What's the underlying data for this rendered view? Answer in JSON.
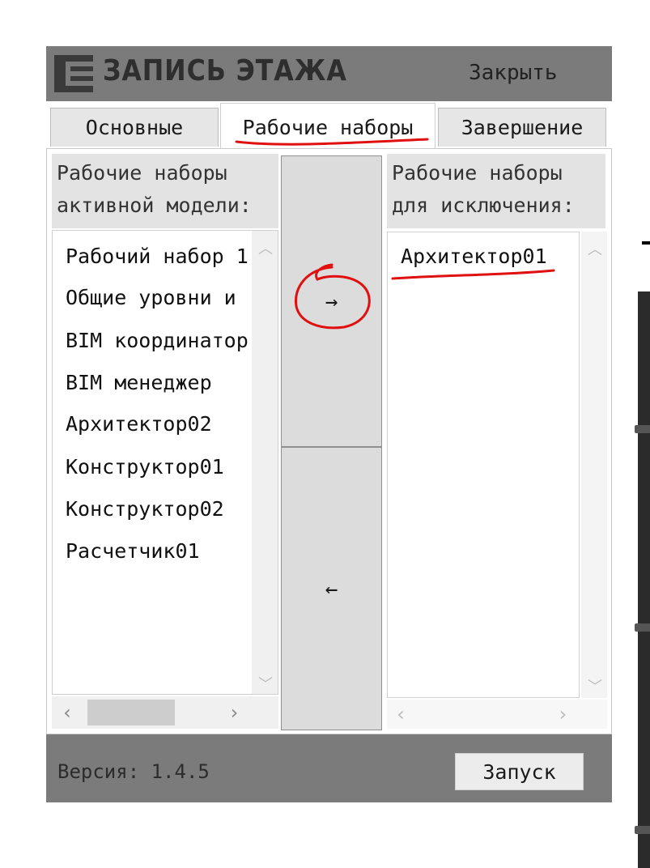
{
  "window": {
    "title": "ЗАПИСЬ ЭТАЖА",
    "close_label": "Закрыть"
  },
  "tabs": [
    {
      "label": "Основные",
      "active": false
    },
    {
      "label": "Рабочие наборы",
      "active": true
    },
    {
      "label": "Завершение",
      "active": false
    }
  ],
  "left_panel": {
    "header_line1": "Рабочие наборы",
    "header_line2": "активной модели:",
    "items": [
      "Рабочий набор 1",
      "Общие уровни и",
      "BIM координатор",
      "BIM менеджер",
      "Архитектор02",
      "Конструктор01",
      "Конструктор02",
      "Расчетчик01"
    ]
  },
  "right_panel": {
    "header_line1": "Рабочие наборы",
    "header_line2": "для исключения:",
    "items": [
      "Архитектор01"
    ]
  },
  "move_buttons": {
    "add": "→",
    "remove": "←"
  },
  "scroll_arrows": {
    "up": "︿",
    "down": "﹀",
    "left": "‹",
    "right": "›"
  },
  "footer": {
    "version": "Версия: 1.4.5",
    "launch_label": "Запуск"
  },
  "colors": {
    "bar": "#7b7b7b",
    "annotation": "#e01010",
    "button": "#dcdcdc"
  }
}
